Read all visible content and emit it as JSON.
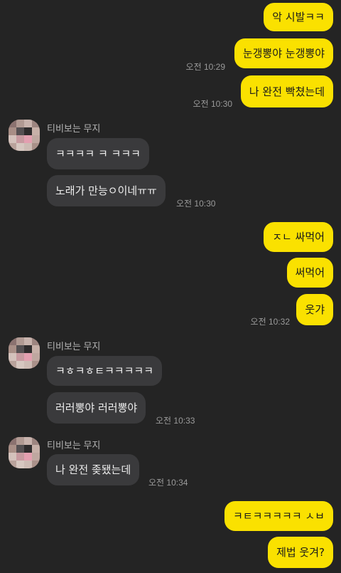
{
  "messages": [
    {
      "id": "m1",
      "text": "악 시발ㅋㅋ"
    },
    {
      "id": "m2",
      "text": "눈갱뽕야 눈갱뽕야",
      "time": "오전 10:29"
    },
    {
      "id": "m3",
      "text": "나 완전 빡쳤는데",
      "time": "오전 10:30"
    },
    {
      "id": "m4",
      "text": "ㅋㅋㅋㅋ ㅋ ㅋㅋㅋ"
    },
    {
      "id": "m5",
      "text": "노래가 만능ㅇ이네ㅠㅠ",
      "time": "오전 10:30"
    },
    {
      "id": "m6",
      "text": "ㅈㄴ 싸먹어"
    },
    {
      "id": "m7",
      "text": "써먹어"
    },
    {
      "id": "m8",
      "text": "웃갸",
      "time": "오전 10:32"
    },
    {
      "id": "m9",
      "text": "ㅋㅎㅋㅎㅌㅋㅋㅋㅋㅋ"
    },
    {
      "id": "m10",
      "text": "러러뽕야 러러뽕야",
      "time": "오전 10:33"
    },
    {
      "id": "m11",
      "text": "나 완전 좆됐는데",
      "time": "오전 10:34"
    },
    {
      "id": "m12",
      "text": "ㅋㅌㅋㅋㅋㅋㅋ ㅅㅂ"
    },
    {
      "id": "m13",
      "text": "제법 웃겨?"
    }
  ],
  "sender": {
    "name": "티비보는 무지"
  },
  "colors": {
    "background": "#242424",
    "my_bubble": "#fae100",
    "other_bubble": "#3a3a3c",
    "timestamp": "#9a9a9a"
  }
}
